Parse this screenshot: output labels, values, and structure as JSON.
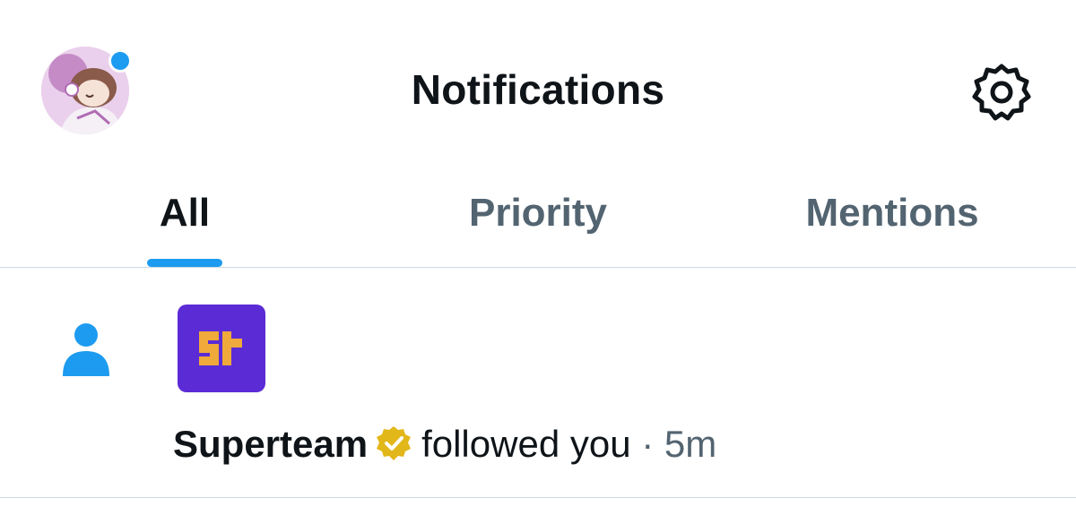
{
  "header": {
    "title": "Notifications",
    "avatar_icon": "profile-avatar",
    "settings_icon": "gear-icon",
    "notification_dot_color": "#1d9bf0"
  },
  "tabs": [
    {
      "label": "All",
      "active": true
    },
    {
      "label": "Priority",
      "active": false
    },
    {
      "label": "Mentions",
      "active": false
    }
  ],
  "notifications": [
    {
      "type_icon": "person-follow-icon",
      "brand_icon": "superteam-logo",
      "name": "Superteam",
      "verified": true,
      "action": "followed you",
      "separator": "·",
      "time": "5m"
    }
  ],
  "colors": {
    "accent": "#1d9bf0",
    "text_primary": "#0f1419",
    "text_secondary": "#536471",
    "divider": "#cfd9de",
    "brand_purple": "#5b2bd6",
    "brand_orange": "#f0a93b",
    "verified_gold": "#e2b719"
  }
}
